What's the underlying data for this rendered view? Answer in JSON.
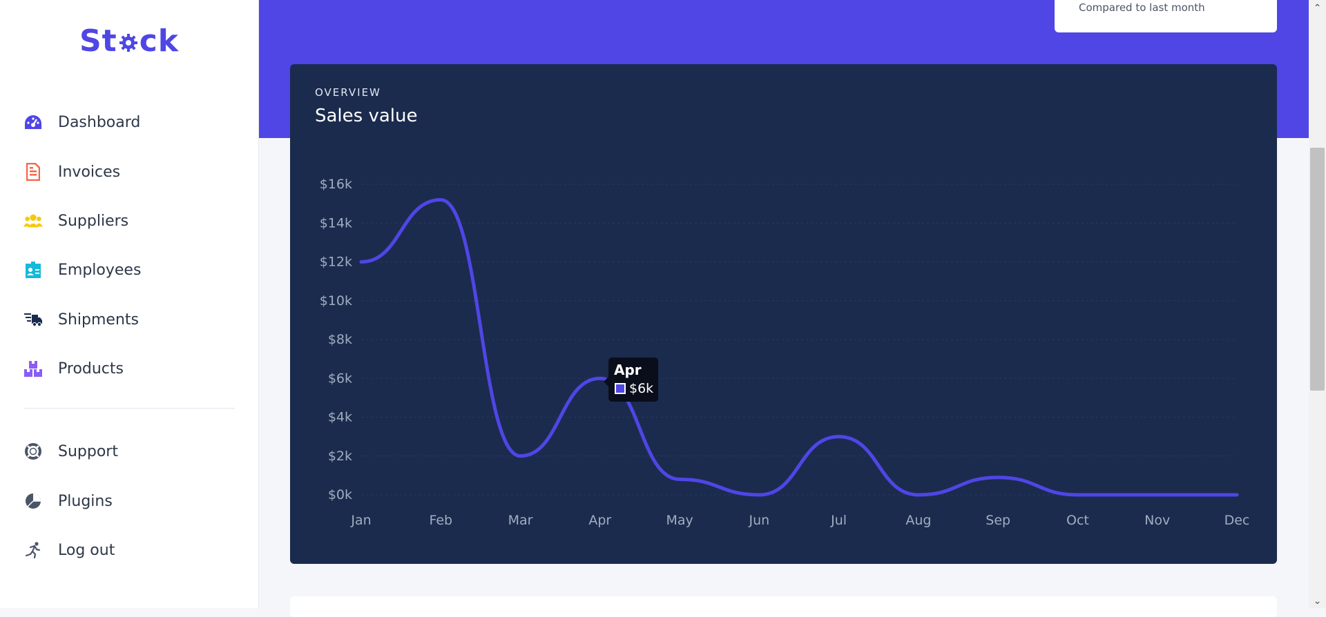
{
  "brand": {
    "logo_text_before": "St",
    "logo_text_after": "ck",
    "color": "#4f46e5"
  },
  "nav": {
    "items": [
      {
        "label": "Dashboard",
        "icon": "dashboard-gauge-icon",
        "color": "#4f46e5"
      },
      {
        "label": "Invoices",
        "icon": "invoice-document-icon",
        "color": "#f56548"
      },
      {
        "label": "Suppliers",
        "icon": "users-group-icon",
        "color": "#f6c90e"
      },
      {
        "label": "Employees",
        "icon": "id-badge-icon",
        "color": "#17b9d9"
      },
      {
        "label": "Shipments",
        "icon": "delivery-truck-icon",
        "color": "#1b2b4e"
      },
      {
        "label": "Products",
        "icon": "boxes-icon",
        "color": "#8b5cf6"
      }
    ],
    "secondary": [
      {
        "label": "Support",
        "icon": "lifebuoy-icon",
        "color": "#4a5568"
      },
      {
        "label": "Plugins",
        "icon": "pie-chart-icon",
        "color": "#4a5568"
      },
      {
        "label": "Log out",
        "icon": "running-person-icon",
        "color": "#4a5568"
      }
    ]
  },
  "stat_card": {
    "subtitle": "Compared to last month"
  },
  "overview": {
    "eyebrow": "OVERVIEW",
    "title": "Sales value"
  },
  "chart_data": {
    "type": "line",
    "categories": [
      "Jan",
      "Feb",
      "Mar",
      "Apr",
      "May",
      "Jun",
      "Jul",
      "Aug",
      "Sep",
      "Oct",
      "Nov",
      "Dec"
    ],
    "series": [
      {
        "values": [
          12000,
          15200,
          2000,
          6000,
          800,
          0,
          3000,
          0,
          900,
          0,
          0,
          0
        ],
        "color": "#4f46e5"
      }
    ],
    "yticks": [
      "$0k",
      "$2k",
      "$4k",
      "$6k",
      "$8k",
      "$10k",
      "$12k",
      "$14k",
      "$16k"
    ],
    "ylim": [
      0,
      16000
    ],
    "grid": true,
    "tooltip": {
      "category": "Apr",
      "value": "$6k"
    }
  },
  "colors": {
    "hero": "#4f46e5",
    "card": "#1b2b4e",
    "line": "#4f46e5"
  }
}
